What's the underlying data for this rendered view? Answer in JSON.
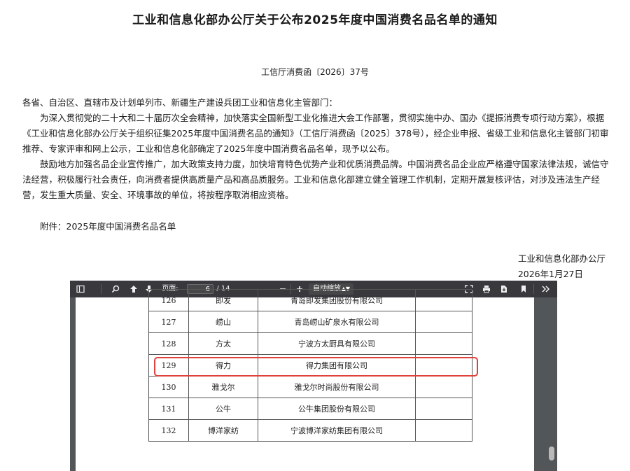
{
  "document": {
    "title": "工业和信息化部办公厅关于公布2025年度中国消费名品名单的通知",
    "number": "工信厅消费函〔2026〕37号",
    "salutation": "各省、自治区、直辖市及计划单列市、新疆生产建设兵团工业和信息化主管部门：",
    "paragraph1": "为深入贯彻党的二十大和二十届历次全会精神，加快落实全国新型工业化推进大会工作部署，贯彻实施中办、国办《提振消费专项行动方案》，根据《工业和信息化部办公厅关于组织征集2025年度中国消费名品的通知》（工信厅消费函〔2025〕378号），经企业申报、省级工业和信息化主管部门初审推荐、专家评审和网上公示，工业和信息化部确定了2025年度中国消费名品名单，现予以公布。",
    "paragraph2": "鼓励地方加强名品企业宣传推广，加大政策支持力度，加快培育特色优势产业和优质消费品牌。中国消费名品企业应严格遵守国家法律法规，诚信守法经营，积极履行社会责任，向消费者提供高质量产品和高品质服务。工业和信息化部建立健全管理工作机制，定期开展复核评估，对涉及违法生产经营，发生重大质量、安全、环境事故的单位，将按程序取消相应资格。",
    "attachment": "附件：2025年度中国消费名品名单",
    "issuer": "工业和信息化部办公厅",
    "date": "2026年1月27日"
  },
  "viewer": {
    "page_label": "页面:",
    "current_page": "6",
    "page_total": "/ 14",
    "zoom": "自动缩放",
    "icons": [
      "sidebar-toggle-icon",
      "search-icon",
      "previous-page-icon",
      "next-page-icon",
      "zoom-out-icon",
      "zoom-in-icon",
      "fullscreen-icon",
      "print-icon",
      "download-icon",
      "bookmark-icon",
      "more-tools-icon"
    ]
  },
  "table_rows": [
    {
      "no": "126",
      "brand": "即发",
      "company": "青岛即发集团股份有限公司"
    },
    {
      "no": "127",
      "brand": "崂山",
      "company": "青岛崂山矿泉水有限公司"
    },
    {
      "no": "128",
      "brand": "方太",
      "company": "宁波方太厨具有限公司"
    },
    {
      "no": "129",
      "brand": "得力",
      "company": "得力集团有限公司"
    },
    {
      "no": "130",
      "brand": "雅戈尔",
      "company": "雅戈尔时尚股份有限公司"
    },
    {
      "no": "131",
      "brand": "公牛",
      "company": "公牛集团股份有限公司"
    },
    {
      "no": "132",
      "brand": "博洋家纺",
      "company": "宁波博洋家纺集团有限公司"
    }
  ],
  "colors": {
    "highlight": "#e0413a",
    "toolbar": "#38383d",
    "viewer_bg": "#525659"
  }
}
